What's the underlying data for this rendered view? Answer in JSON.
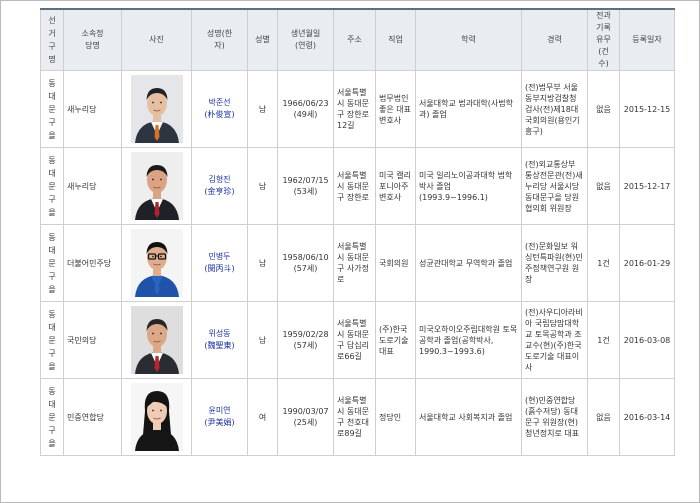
{
  "headers": {
    "district": "선거구명",
    "party": "소속정당명",
    "photo": "사진",
    "name": "성명(한자)",
    "gender": "성별",
    "birth": "생년월일(연령)",
    "address": "주소",
    "job": "직업",
    "education": "학력",
    "career": "경력",
    "record": "전과기록유무(건수)",
    "regdate": "등록일자"
  },
  "rows": [
    {
      "district": "동대문구을",
      "party": "새누리당",
      "photo": "photo-man-suit-orange-tie",
      "name": "박준선",
      "hanja": "(朴俊宣)",
      "gender": "남",
      "birth": "1966/06/23",
      "age": "(49세)",
      "address": "서울특별시 동대문구 장한로12길",
      "job": "법무법인 좋은 대표변호사",
      "education": "서울대학교 법과대학(사법학과) 졸업",
      "career": "(전)법무부 서울동부지방검찰청 검사(전)제18대 국회의원(용인기흥구)",
      "record": "없음",
      "regdate": "2015-12-15"
    },
    {
      "district": "동대문구을",
      "party": "새누리당",
      "photo": "photo-man-suit-red-tie",
      "name": "김형진",
      "hanja": "(金亨珍)",
      "gender": "남",
      "birth": "1962/07/15",
      "age": "(53세)",
      "address": "서울특별시 동대문구 장한로",
      "job": "미국 캘리포니아주 변호사",
      "education": "미국 일리노이공과대학 법학박사 졸업 (1993.9~1996.1)",
      "career": "(전)외교통상부 통상전문관(전)새누리당 서울시당 동대문구을 당원협의회 위원장",
      "record": "없음",
      "regdate": "2015-12-17"
    },
    {
      "district": "동대문구을",
      "party": "더불어민주당",
      "photo": "photo-man-blue-jacket",
      "name": "민병두",
      "hanja": "(閔丙斗)",
      "gender": "남",
      "birth": "1958/06/10",
      "age": "(57세)",
      "address": "서울특별시 동대문구 사가정로",
      "job": "국회의원",
      "education": "성균관대학교 무역학과 졸업",
      "career": "(전)문화일보 워싱턴특파원(현)민주정책연구원 원장",
      "record": "1건",
      "regdate": "2016-01-29"
    },
    {
      "district": "동대문구을",
      "party": "국민의당",
      "photo": "photo-man-suit-red-tie-2",
      "name": "위성동",
      "hanja": "(魏聖東)",
      "gender": "남",
      "birth": "1959/02/28",
      "age": "(57세)",
      "address": "서울특별시 동대문구 답십리로66길",
      "job": "(주)한국도로기술 대표",
      "education": "미국오하이오주립대학원 토목공학과 졸업(공학박사, 1990.3~1993.6)",
      "career": "(전)사우디아라비아 국립담맘대학교 토목공학과 조교수(현)(주)한국도로기술 대표이사",
      "record": "1건",
      "regdate": "2016-03-08"
    },
    {
      "district": "동대문구을",
      "party": "민중연합당",
      "photo": "photo-woman",
      "name": "윤미연",
      "hanja": "(尹美娟)",
      "gender": "여",
      "birth": "1990/03/07",
      "age": "(25세)",
      "address": "서울특별시 동대문구 천호대로89길",
      "job": "정당인",
      "education": "서울대학교 사회복지과 졸업",
      "career": "(현)민중연합당(흙수저당) 동대문구 위원장(현)청년정치로 대표",
      "record": "없음",
      "regdate": "2016-03-14"
    }
  ]
}
